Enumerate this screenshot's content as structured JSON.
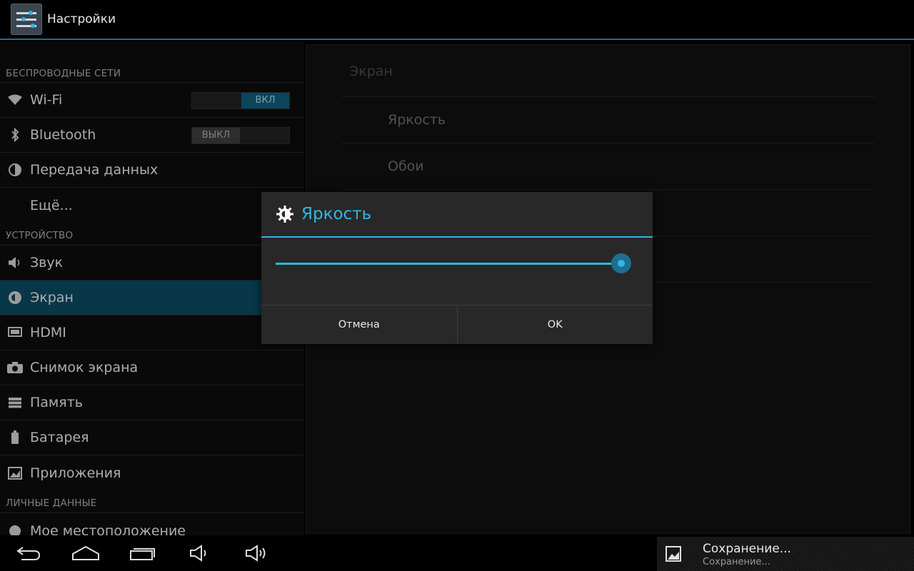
{
  "app": {
    "title": "Настройки"
  },
  "sidebar": {
    "sections": [
      {
        "label": "БЕСПРОВОДНЫЕ СЕТИ"
      },
      {
        "label": "УСТРОЙСТВО"
      },
      {
        "label": "ЛИЧНЫЕ ДАННЫЕ"
      }
    ],
    "wireless": [
      {
        "label": "Wi-Fi",
        "icon": "wifi-icon",
        "toggle": "ВКЛ"
      },
      {
        "label": "Bluetooth",
        "icon": "bluetooth-icon",
        "toggle": "ВЫКЛ"
      },
      {
        "label": "Передача данных",
        "icon": "data-usage-icon"
      },
      {
        "label": "Ещё..."
      }
    ],
    "device": [
      {
        "label": "Звук",
        "icon": "speaker-icon"
      },
      {
        "label": "Экран",
        "icon": "brightness-icon",
        "selected": true
      },
      {
        "label": "HDMI",
        "icon": "hdmi-icon"
      },
      {
        "label": "Снимок экрана",
        "icon": "camera-icon"
      },
      {
        "label": "Память",
        "icon": "storage-icon"
      },
      {
        "label": "Батарея",
        "icon": "battery-icon"
      },
      {
        "label": "Приложения",
        "icon": "apps-icon"
      }
    ],
    "personal": [
      {
        "label": "Мое местоположение",
        "icon": "location-icon"
      }
    ]
  },
  "detail": {
    "header": "Экран",
    "items": [
      "Яркость",
      "Обои"
    ]
  },
  "dialog": {
    "title": "Яркость",
    "icon": "brightness-icon",
    "brightness_fraction": 0.98,
    "cancel_label": "Отмена",
    "ok_label": "OK"
  },
  "notification": {
    "icon": "image-icon",
    "title": "Сохранение...",
    "subtitle": "Сохранение..."
  },
  "navbar": {
    "buttons": [
      "back-icon",
      "home-icon",
      "recent-apps-icon",
      "volume-down-icon",
      "volume-up-icon"
    ]
  },
  "colors": {
    "accent": "#33b5e5",
    "selected": "#0a4a62"
  }
}
